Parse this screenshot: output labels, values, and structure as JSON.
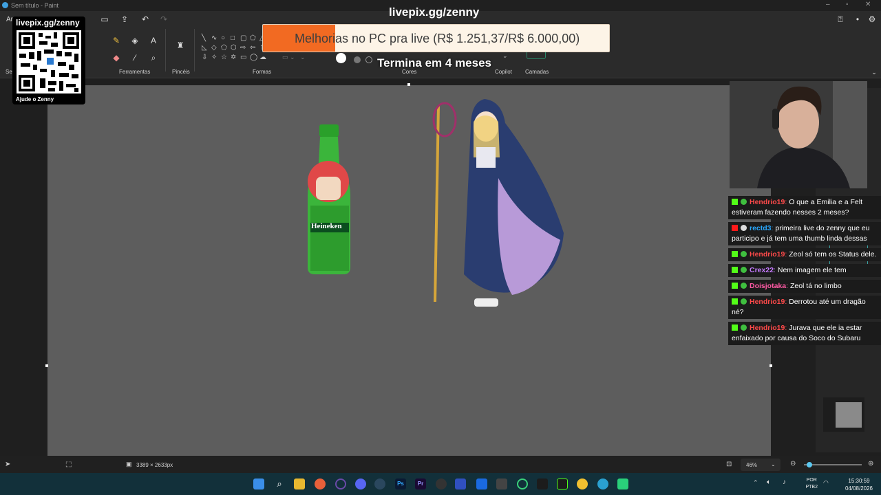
{
  "window": {
    "title": "Sem título - Paint"
  },
  "ribbon": {
    "tab_partial": "Ar",
    "select_partial": "Sel",
    "groups": {
      "tools": "Ferramentas",
      "brushes": "Pincéis",
      "shapes": "Formas",
      "colors": "Cores",
      "copilot": "Copilot",
      "layers": "Camadas"
    }
  },
  "overlay": {
    "qr_url": "livepix.gg/zenny",
    "qr_caption": "Ajude o Zenny",
    "goal_title": "livepix.gg/zenny",
    "goal_text": "Melhorias no PC pra live (R$ 1.251,37/R$ 6.000,00)",
    "goal_progress": 0.2086,
    "goal_deadline": "Termina em 4 meses",
    "accent": "#f26a22"
  },
  "chat": {
    "messages": [
      {
        "user": "Hendrio19",
        "color": "#ff4a4a",
        "text": "O que a Emilia e a Felt estiveram fazendo nesses 2 meses?",
        "badge": "kick"
      },
      {
        "user": "rectd3",
        "color": "#29a8ff",
        "text": "primeira live do zenny que eu participo e já tem uma thumb linda dessas",
        "badge": "youtube"
      },
      {
        "user": "Hendrio19",
        "color": "#ff4a4a",
        "text": "Zeol só tem os Status dele.",
        "badge": "kick"
      },
      {
        "user": "Crex22",
        "color": "#c67bff",
        "text": "Nem imagem ele tem",
        "badge": "kick"
      },
      {
        "user": "Doisjotaka",
        "color": "#ff5aa5",
        "text": "Zeol tá no limbo",
        "badge": "kick"
      },
      {
        "user": "Hendrio19",
        "color": "#ff4a4a",
        "text": "Derrotou até um dragão né?",
        "badge": "kick"
      },
      {
        "user": "Hendrio19",
        "color": "#ff4a4a",
        "text": "Jurava que ele ia estar enfaixado por causa do Soco do Subaru",
        "badge": "kick"
      }
    ]
  },
  "statusbar": {
    "dimensions": "3389 × 2633px",
    "zoom": "46%"
  },
  "taskbar": {
    "lang": "POR",
    "layout": "PTB2",
    "time": "15:30:59",
    "date": "04/08/2026"
  },
  "canvas": {
    "bottle_label": "Heineken"
  }
}
